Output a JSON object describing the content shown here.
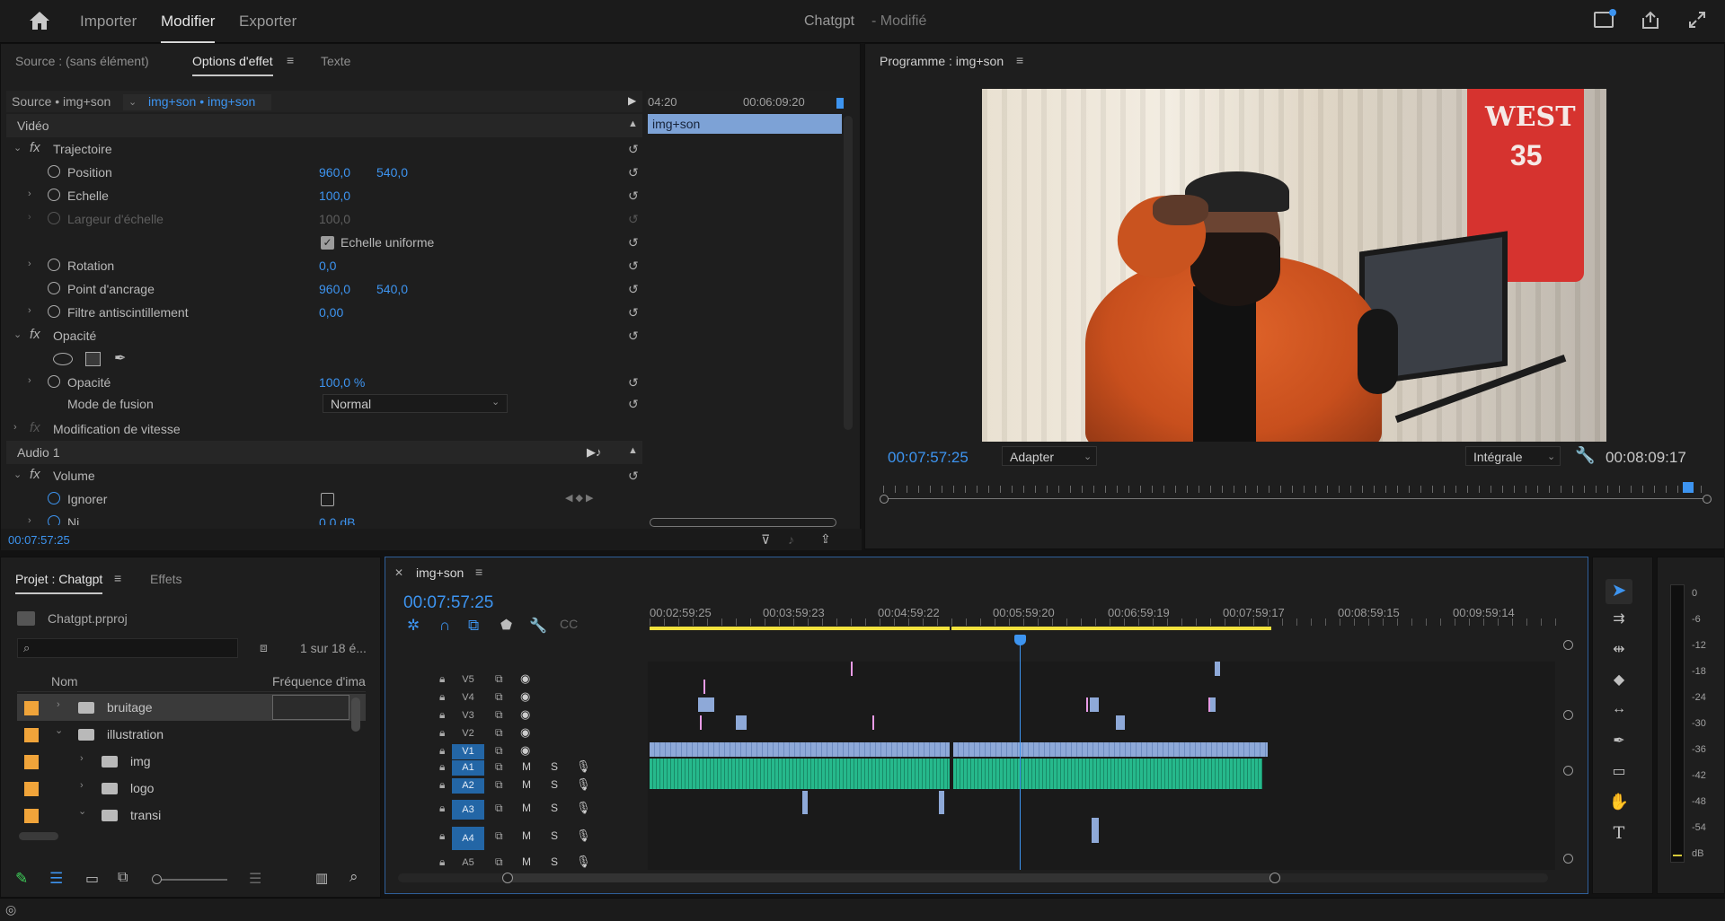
{
  "header": {
    "nav": [
      "Importer",
      "Modifier",
      "Exporter"
    ],
    "active": "Modifier",
    "project_title": "Chatgpt",
    "project_status": "- Modifié"
  },
  "effect_controls": {
    "tabs": [
      "Source : (sans élément)",
      "Options d'effet",
      "Texte"
    ],
    "source_label": "Source • img+son",
    "sequence_label": "img+son • img+son",
    "ruler": [
      "04:20",
      "00:06:09:20"
    ],
    "clip_name": "img+son",
    "section_video": "Vidéo",
    "fx_trajectoire": "Trajectoire",
    "position_label": "Position",
    "position_x": "960,0",
    "position_y": "540,0",
    "echelle_label": "Echelle",
    "echelle_val": "100,0",
    "largeur_label": "Largeur d'échelle",
    "largeur_val": "100,0",
    "uniform_label": "Echelle uniforme",
    "rotation_label": "Rotation",
    "rotation_val": "0,0",
    "ancrage_label": "Point d'ancrage",
    "ancrage_x": "960,0",
    "ancrage_y": "540,0",
    "filtre_label": "Filtre antiscintillement",
    "filtre_val": "0,00",
    "fx_opacite": "Opacité",
    "opacite_label": "Opacité",
    "opacite_val": "100,0 %",
    "fusion_label": "Mode de fusion",
    "fusion_val": "Normal",
    "fx_vitesse": "Modification de vitesse",
    "section_audio": "Audio 1",
    "fx_volume": "Volume",
    "ignorer_label": "Ignorer",
    "next_label": "Ni...",
    "next_val": "0,0 dB",
    "timecode": "00:07:57:25"
  },
  "program": {
    "title": "Programme : img+son",
    "timecode": "00:07:57:25",
    "fit": "Adapter",
    "quality": "Intégrale",
    "duration": "00:08:09:17",
    "jersey_text": "WEST",
    "jersey_number": "35"
  },
  "project": {
    "tabs": [
      "Projet : Chatgpt",
      "Effets"
    ],
    "file": "Chatgpt.prproj",
    "count": "1 sur 18 é...",
    "columns": [
      "Nom",
      "Fréquence d'ima"
    ],
    "items": [
      {
        "name": "bruitage",
        "level": 0,
        "open": false
      },
      {
        "name": "illustration",
        "level": 0,
        "open": true
      },
      {
        "name": "img",
        "level": 1,
        "open": false
      },
      {
        "name": "logo",
        "level": 1,
        "open": false
      },
      {
        "name": "transi",
        "level": 1,
        "open": true
      }
    ]
  },
  "timeline": {
    "tab": "img+son",
    "timecode": "00:07:57:25",
    "ruler": [
      "00:02:59:25",
      "00:03:59:23",
      "00:04:59:22",
      "00:05:59:20",
      "00:06:59:19",
      "00:07:59:17",
      "00:08:59:15",
      "00:09:59:14"
    ],
    "video_tracks": [
      "V5",
      "V4",
      "V3",
      "V2",
      "V1"
    ],
    "audio_tracks": [
      "A1",
      "A2",
      "A3",
      "A4",
      "A5"
    ],
    "mute": "M",
    "solo": "S"
  },
  "meter": {
    "scale": [
      "0",
      "-6",
      "-12",
      "-18",
      "-24",
      "-30",
      "-36",
      "-42",
      "-48",
      "-54",
      "dB"
    ]
  },
  "colors": {
    "accent": "#3d94f0",
    "video_clip": "#8ea9d8",
    "audio_clip": "#22b086",
    "label_orange": "#f0a43a",
    "marker_pink": "#e89be6"
  }
}
